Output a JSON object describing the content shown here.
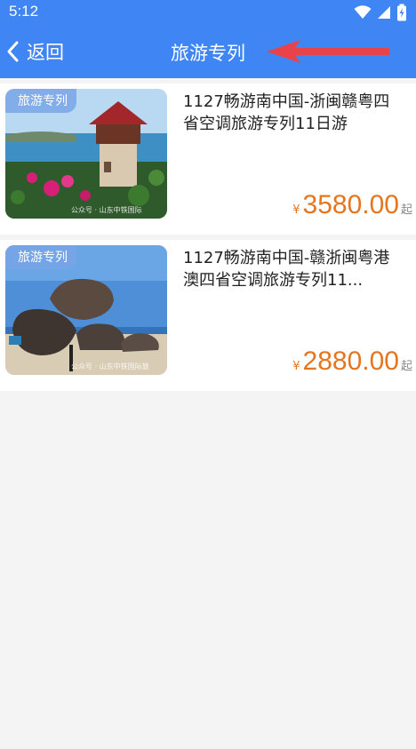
{
  "status": {
    "time": "5:12"
  },
  "nav": {
    "back_label": "返回",
    "title": "旅游专列"
  },
  "items": [
    {
      "tag": "旅游专列",
      "title": "1127畅游南中国-浙闽赣粤四省空调旅游专列11日游",
      "currency": "¥",
      "price": "3580.00",
      "price_suffix": "起",
      "watermark": "公众号 · 山东中铁国际"
    },
    {
      "tag": "旅游专列",
      "title": "1127畅游南中国-赣浙闽粤港澳四省空调旅游专列11...",
      "currency": "¥",
      "price": "2880.00",
      "price_suffix": "起",
      "watermark": "公众号 · 山东中铁国际旅"
    }
  ],
  "colors": {
    "primary": "#3f86f4",
    "price": "#e5761f",
    "annotation": "#e8424b"
  },
  "icons": [
    "wifi-icon",
    "signal-icon",
    "battery-icon",
    "chevron-left-icon",
    "annotation-arrow-icon"
  ]
}
